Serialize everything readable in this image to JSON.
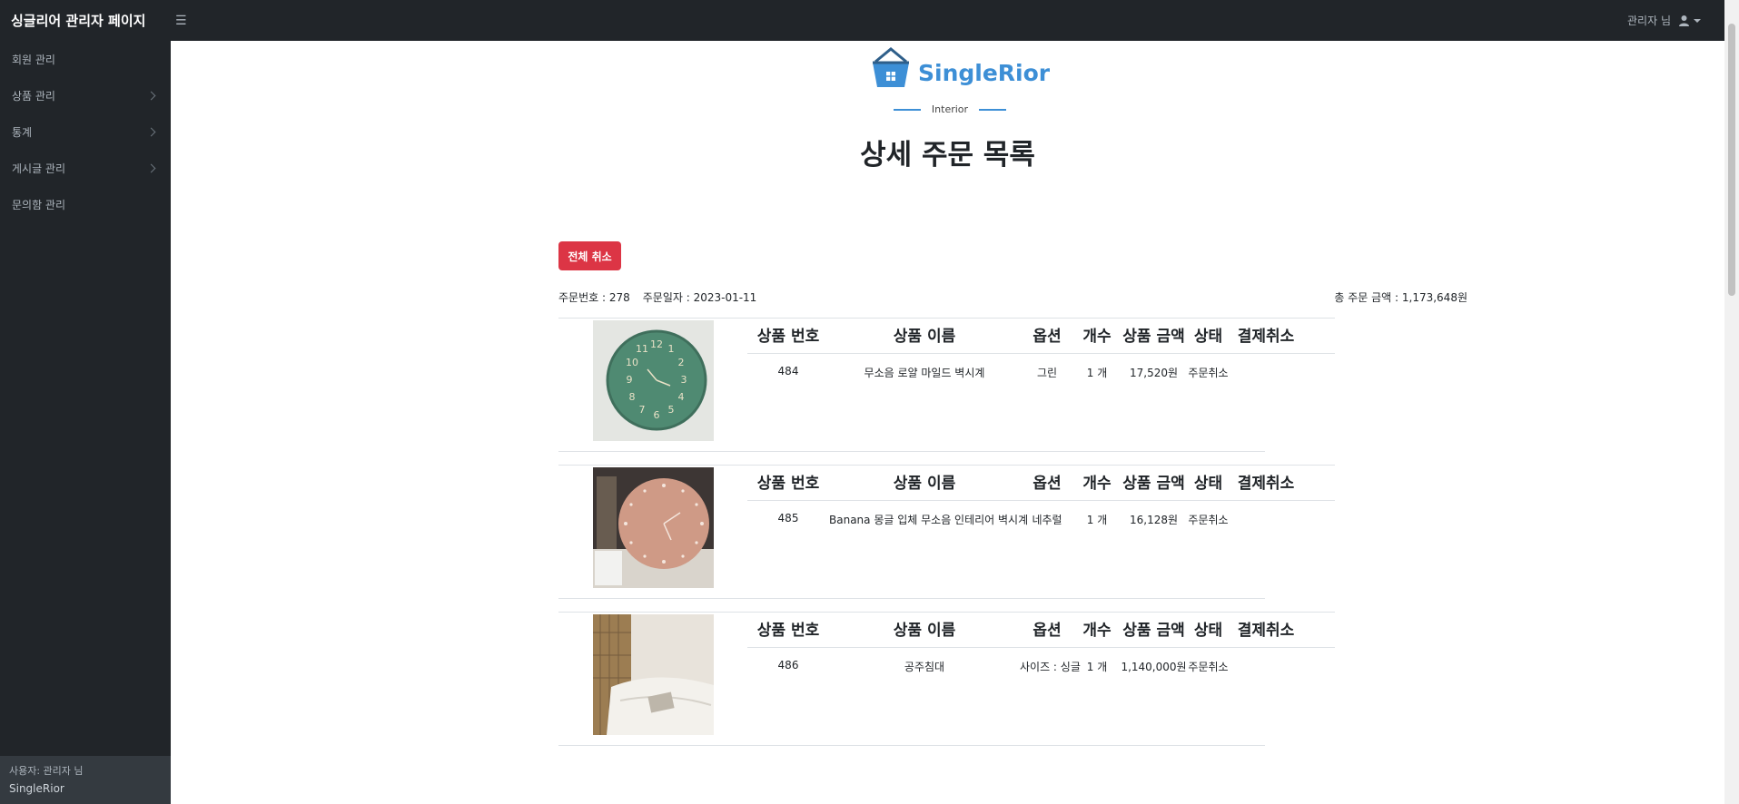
{
  "topnav": {
    "brand": "싱글리어 관리자 페이지",
    "menu_icon": "☰",
    "user_label": "관리자 님"
  },
  "sidebar": {
    "items": [
      {
        "label": "회원 관리",
        "has_children": false
      },
      {
        "label": "상품 관리",
        "has_children": true
      },
      {
        "label": "통계",
        "has_children": true
      },
      {
        "label": "게시글 관리",
        "has_children": true
      },
      {
        "label": "문의함 관리",
        "has_children": false
      }
    ],
    "footer": {
      "user": "사용자: 관리자 님",
      "site": "SingleRior"
    }
  },
  "logo": {
    "text": "SingleRior",
    "sub": "Interior"
  },
  "page_title": "상세 주문 목록",
  "cancel_all_label": "전체 취소",
  "order": {
    "number": "주문번호 : 278",
    "date": "주문일자 : 2023-01-11",
    "total": "총 주문 금액 : 1,173,648원"
  },
  "columns": {
    "no": "상품 번호",
    "name": "상품 이름",
    "option": "옵션",
    "qty": "개수",
    "price": "상품 금액",
    "status": "상태",
    "cancel": "결제취소"
  },
  "items": [
    {
      "no": "484",
      "name": "무소음 로얄 마일드 벽시계",
      "option": "그린",
      "qty": "1 개",
      "price": "17,520원",
      "status": "주문취소",
      "image": "green-clock"
    },
    {
      "no": "485",
      "name": "Banana 몽글 입체 무소음 인테리어 벽시계",
      "option": "네추럴",
      "qty": "1 개",
      "price": "16,128원",
      "status": "주문취소",
      "image": "pink-clock"
    },
    {
      "no": "486",
      "name": "공주침대",
      "option": "사이즈 : 싱글",
      "qty": "1 개",
      "price": "1,140,000원",
      "status": "주문취소",
      "image": "bed"
    }
  ]
}
